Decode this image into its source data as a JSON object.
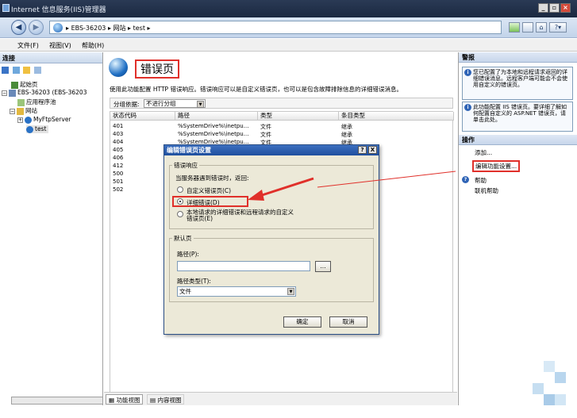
{
  "window": {
    "title": "Internet 信息服务(IIS)管理器"
  },
  "address": {
    "crumbs": [
      "EBS-36203",
      "网站",
      "test"
    ],
    "separator": "▸"
  },
  "menu": {
    "items": [
      "文件(F)",
      "视图(V)",
      "帮助(H)"
    ]
  },
  "left_pane": {
    "header": "连接",
    "tree": [
      {
        "label": "起始页",
        "level": 0
      },
      {
        "label": "EBS-36203 (EBS-36203",
        "level": 0
      },
      {
        "label": "应用程序池",
        "level": 1
      },
      {
        "label": "网站",
        "level": 1
      },
      {
        "label": "MyFtpServer",
        "level": 2
      },
      {
        "label": "test",
        "level": 2
      }
    ]
  },
  "main": {
    "title": "错误页",
    "description": "使用此功能配置 HTTP 错误响应。错误响应可以是自定义错误页，也可以是包含故障排除信息的详细错误消息。",
    "group_label": "分组依据:",
    "group_value": "不进行分组",
    "columns": [
      "状态代码",
      "路径",
      "类型",
      "条目类型"
    ],
    "rows": [
      {
        "code": "401",
        "path": "%SystemDrive%\\inetpu...",
        "type": "文件",
        "entry": "继承"
      },
      {
        "code": "403",
        "path": "%SystemDrive%\\inetpu...",
        "type": "文件",
        "entry": "继承"
      },
      {
        "code": "404",
        "path": "%SystemDrive%\\inetpu...",
        "type": "文件",
        "entry": "继承"
      },
      {
        "code": "405",
        "path": "",
        "type": "",
        "entry": ""
      },
      {
        "code": "406",
        "path": "",
        "type": "",
        "entry": ""
      },
      {
        "code": "412",
        "path": "",
        "type": "",
        "entry": ""
      },
      {
        "code": "500",
        "path": "",
        "type": "",
        "entry": ""
      },
      {
        "code": "501",
        "path": "",
        "type": "",
        "entry": ""
      },
      {
        "code": "502",
        "path": "",
        "type": "",
        "entry": ""
      }
    ],
    "tabs": {
      "features": "功能视图",
      "content": "内容视图"
    }
  },
  "right_pane": {
    "alerts_header": "警报",
    "alert1": "您已配置了为本地和远程请求返回的详细错误消息。远程客户端可能会不会使用自定义的错误页。",
    "alert2": "此功能配置 IIS 错误页。要详细了解如何配置自定义的 ASP.NET 错误页，请单击此处。",
    "actions_header": "操作",
    "actions": [
      "添加...",
      "编辑功能设置...",
      "帮助",
      "联机帮助"
    ]
  },
  "dialog": {
    "title": "编辑错误页设置",
    "help_btn": "?",
    "close_btn": "X",
    "group1_legend": "错误响应",
    "group1_prompt": "当服务器遇到错误时，返回:",
    "options": [
      "自定义错误页(C)",
      "详细错误(D)",
      "本地请求的详细错误和远程请求的自定义错误页(E)"
    ],
    "selected_option": 1,
    "group2_legend": "默认页",
    "path_label": "路径(P):",
    "path_value": "",
    "browse_btn": "...",
    "pathtype_label": "路径类型(T):",
    "pathtype_value": "文件",
    "ok": "确定",
    "cancel": "取消"
  },
  "colors": {
    "accent_red": "#e0302a",
    "title_bar": "#1b2940",
    "link": "#0a3c8c"
  }
}
